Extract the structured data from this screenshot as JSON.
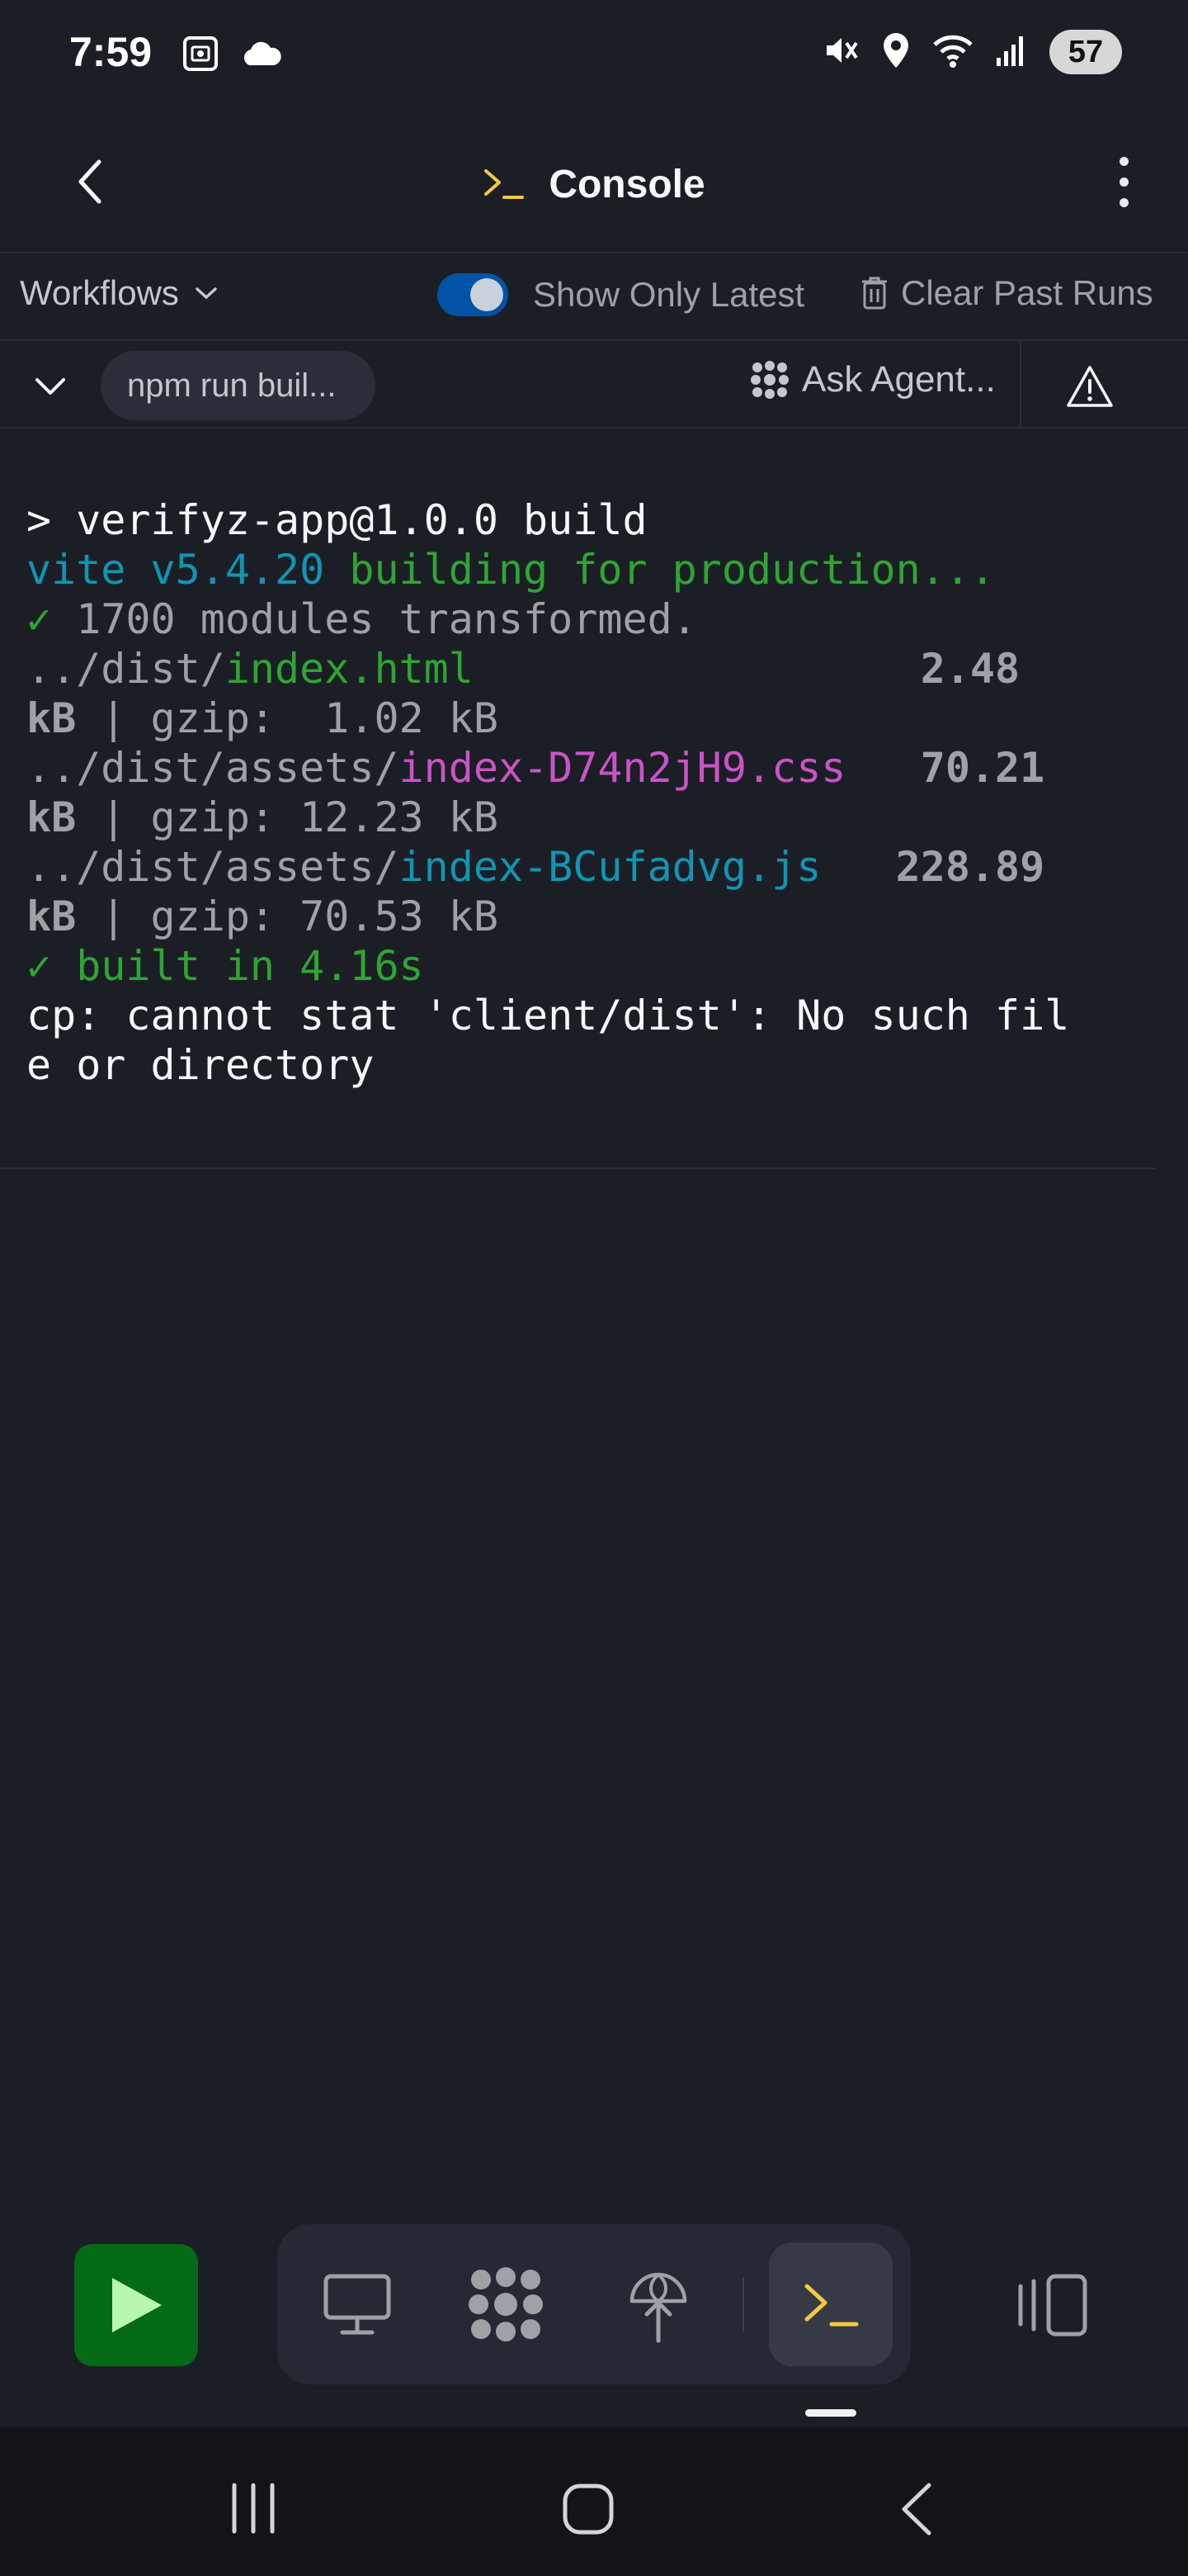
{
  "status_bar": {
    "time": "7:59",
    "battery": "57",
    "icons": [
      "screenshot-icon",
      "cloud-icon",
      "mute-icon",
      "location-icon",
      "wifi-icon",
      "signal-icon",
      "battery-icon"
    ]
  },
  "header": {
    "title": "Console",
    "title_icon": "terminal-icon",
    "back_icon": "chevron-left-icon",
    "menu_icon": "more-vertical-icon"
  },
  "workflows_bar": {
    "select_label": "Workflows",
    "toggle_label": "Show Only Latest",
    "toggle_on": true,
    "clear_label": "Clear Past Runs"
  },
  "run_bar": {
    "run_name": "npm run buil...",
    "ask_agent_label": "Ask Agent...",
    "warning_icon": "warning-triangle-icon"
  },
  "console": {
    "line1": "> verifyz-app@1.0.0 build",
    "vite_version": "vite v5.4.20",
    "building": " building for production...",
    "check1": "✓",
    "modules": " 1700 modules transformed.",
    "f1_dir": "../dist/",
    "f1_name": "index.html",
    "f1_pad": "                  ",
    "f1_size": "2.48",
    "f1_unit": "kB",
    "f1_gzip": " | gzip:  1.02 kB",
    "f2_dir": "../dist/assets/",
    "f2_name": "index-D74n2jH9.css",
    "f2_pad": "   ",
    "f2_size": "70.21",
    "f2_unit": "kB",
    "f2_gzip": " | gzip: 12.23 kB",
    "f3_dir": "../dist/assets/",
    "f3_name": "index-BCufadvg.js",
    "f3_pad": "   ",
    "f3_size": "228.89",
    "f3_unit": "kB",
    "f3_gzip": " | gzip: 70.53 kB",
    "check2": "✓",
    "built": " built in 4.16s",
    "err1": "cp: cannot stat 'client/dist': No such fil",
    "err2": "e or directory"
  },
  "toolbar": {
    "run_icon": "play-icon",
    "tools": [
      "monitor-icon",
      "agent-icon",
      "deploy-icon",
      "terminal-icon"
    ],
    "active_tool": "terminal-icon",
    "panel_icon": "panels-icon"
  },
  "android_nav": {
    "icons": [
      "recents-icon",
      "home-icon",
      "back-icon"
    ]
  },
  "colors": {
    "background": "#1c1e26",
    "cyan": "#0f96b4",
    "green": "#2ea632",
    "magenta": "#c954c6",
    "accent_yellow": "#f5c842",
    "toggle_blue": "#0053a6",
    "run_green": "#056a16"
  }
}
